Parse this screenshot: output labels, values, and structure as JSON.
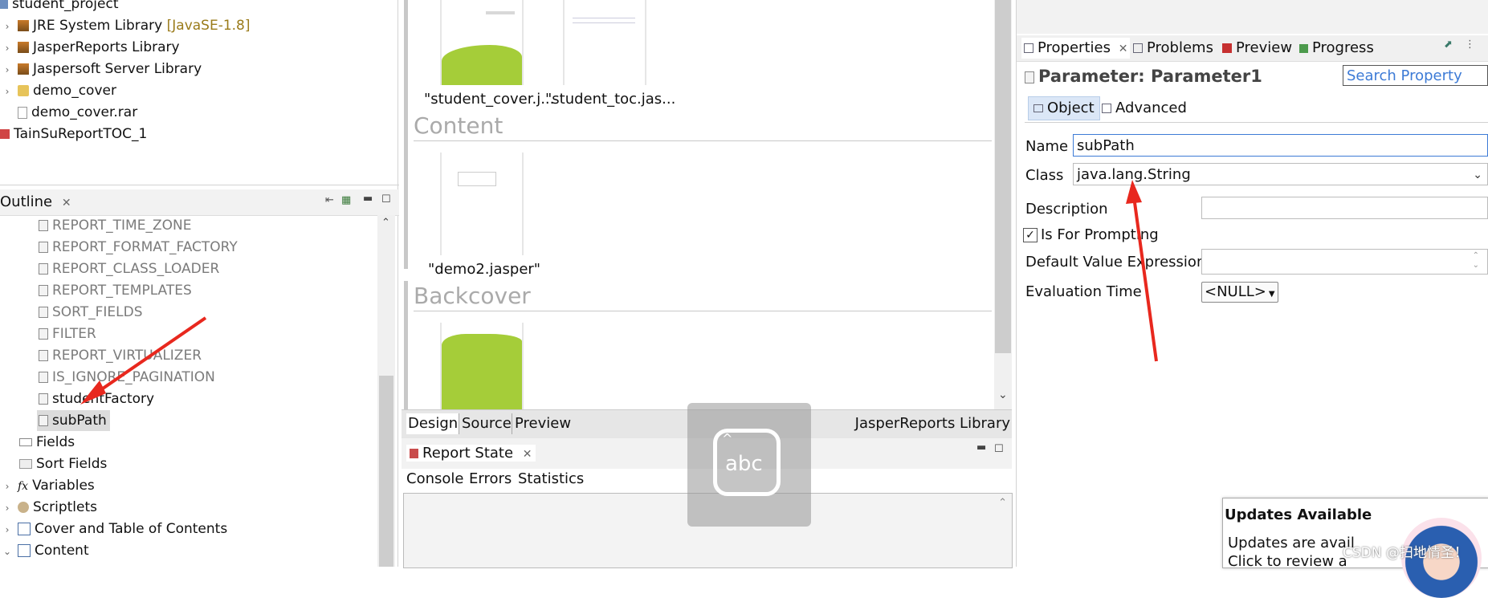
{
  "project_tree": {
    "items": [
      {
        "label": "student_project",
        "extra": ""
      },
      {
        "label": "JRE System Library",
        "extra": "[JavaSE-1.8]"
      },
      {
        "label": "JasperReports Library",
        "extra": ""
      },
      {
        "label": "Jaspersoft Server Library",
        "extra": ""
      },
      {
        "label": "demo_cover",
        "extra": ""
      },
      {
        "label": "demo_cover.rar",
        "extra": ""
      },
      {
        "label": "TainSuReportTOC_1",
        "extra": ""
      }
    ]
  },
  "outline": {
    "title": "Outline",
    "params": [
      "REPORT_TIME_ZONE",
      "REPORT_FORMAT_FACTORY",
      "REPORT_CLASS_LOADER",
      "REPORT_TEMPLATES",
      "SORT_FIELDS",
      "FILTER",
      "REPORT_VIRTUALIZER",
      "IS_IGNORE_PAGINATION",
      "studentFactory",
      "subPath"
    ],
    "groups": [
      "Fields",
      "Sort Fields",
      "Variables",
      "Scriptlets",
      "Cover and Table of Contents",
      "Content"
    ],
    "variables_prefix": "fx"
  },
  "editor": {
    "thumb_cover": "\"student_cover.j...",
    "thumb_toc": "\"student_toc.jas...",
    "section_content": "Content",
    "thumb_demo2": "\"demo2.jasper\"",
    "section_backcover": "Backcover",
    "tabs": [
      "Design",
      "Source",
      "Preview"
    ],
    "library": "JasperReports Library"
  },
  "report_state": {
    "title": "Report State",
    "tabs": [
      "Console",
      "Errors",
      "Statistics"
    ]
  },
  "properties": {
    "tabs": [
      "Properties",
      "Problems",
      "Preview",
      "Progress"
    ],
    "header": "Parameter: Parameter1",
    "search_placeholder": "Search Property",
    "subtabs": [
      "Object",
      "Advanced"
    ],
    "name_label": "Name",
    "name_value": "subPath",
    "class_label": "Class",
    "class_value": "java.lang.String",
    "description_label": "Description",
    "prompting_label": "Is For Prompting",
    "prompting_checked": true,
    "default_label": "Default Value Expression",
    "eval_label": "Evaluation Time",
    "eval_value": "<NULL>"
  },
  "ime": {
    "label": "abc"
  },
  "updates": {
    "title": "Updates Available",
    "line1": "Updates are avail",
    "line2": "Click to review a"
  },
  "watermark": "CSDN @扫地情圣！",
  "colors": {
    "accent": "#3d7bd6",
    "green": "#a5cd39",
    "arrow": "#e8281e"
  }
}
